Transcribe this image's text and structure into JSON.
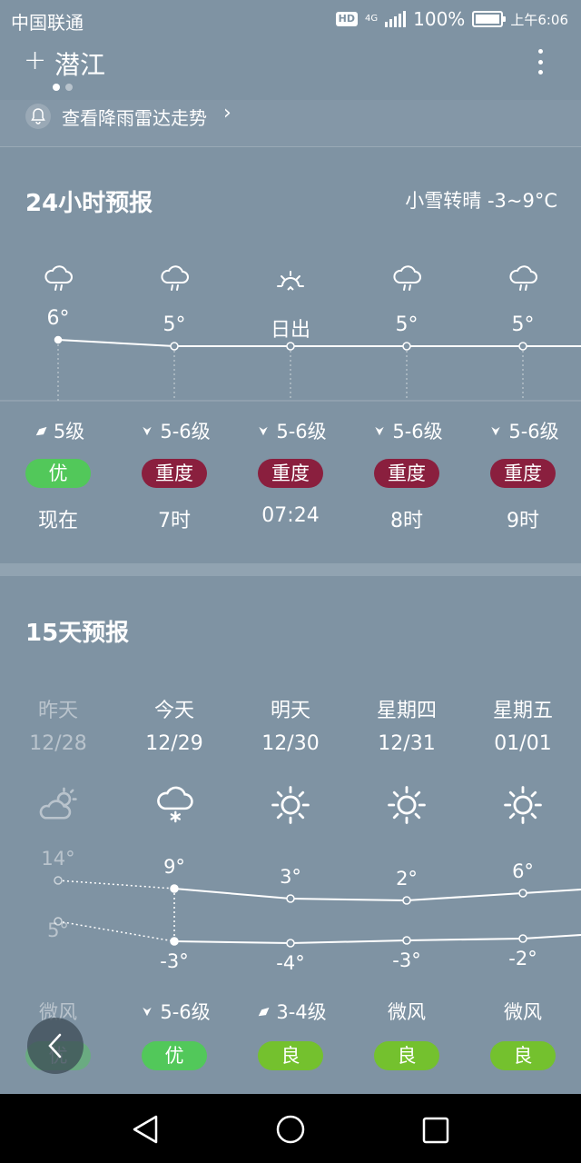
{
  "status": {
    "carrier": "中国联通",
    "hd": "HD",
    "net": "4G",
    "battery": "100%",
    "time": "上午6:06"
  },
  "header": {
    "city": "潜江",
    "page_count": 2,
    "active_page": 0
  },
  "radar": {
    "label": "查看降雨雷达走势",
    "chevron": "›"
  },
  "forecast24": {
    "title": "24小时预报",
    "summary": "小雪转晴 -3~9°C",
    "items": [
      {
        "icon": "cloud-drizzle-icon",
        "temp": "6°",
        "wind_icon": "wind-direction-northeast-icon",
        "wind": "5级",
        "aqi": "优",
        "aqi_level": "good",
        "time": "现在"
      },
      {
        "icon": "cloud-drizzle-icon",
        "temp": "5°",
        "wind_icon": "wind-direction-south-icon",
        "wind": "5-6级",
        "aqi": "重度",
        "aqi_level": "heavy",
        "time": "7时"
      },
      {
        "icon": "sunrise-icon",
        "temp": "日出",
        "wind_icon": "wind-direction-south-icon",
        "wind": "5-6级",
        "aqi": "重度",
        "aqi_level": "heavy",
        "time": "07:24"
      },
      {
        "icon": "cloud-drizzle-icon",
        "temp": "5°",
        "wind_icon": "wind-direction-south-icon",
        "wind": "5-6级",
        "aqi": "重度",
        "aqi_level": "heavy",
        "time": "8时"
      },
      {
        "icon": "cloud-drizzle-icon",
        "temp": "5°",
        "wind_icon": "wind-direction-south-icon",
        "wind": "5-6级",
        "aqi": "重度",
        "aqi_level": "heavy",
        "time": "9时"
      }
    ]
  },
  "forecast15": {
    "title": "15天预报",
    "days": [
      {
        "day": "昨天",
        "date": "12/28",
        "icon": "partly-cloudy-icon",
        "high": "14°",
        "low": "5°",
        "wind_icon": "",
        "wind": "微风",
        "aqi": "优",
        "aqi_level": "good",
        "past": true
      },
      {
        "day": "今天",
        "date": "12/29",
        "icon": "snow-icon",
        "high": "9°",
        "low": "-3°",
        "wind_icon": "wind-direction-south-icon",
        "wind": "5-6级",
        "aqi": "优",
        "aqi_level": "good",
        "past": false
      },
      {
        "day": "明天",
        "date": "12/30",
        "icon": "sun-icon",
        "high": "3°",
        "low": "-4°",
        "wind_icon": "wind-direction-northeast-icon",
        "wind": "3-4级",
        "aqi": "良",
        "aqi_level": "ok",
        "past": false
      },
      {
        "day": "星期四",
        "date": "12/31",
        "icon": "sun-icon",
        "high": "2°",
        "low": "-3°",
        "wind_icon": "",
        "wind": "微风",
        "aqi": "良",
        "aqi_level": "ok",
        "past": false
      },
      {
        "day": "星期五",
        "date": "01/01",
        "icon": "sun-icon",
        "high": "6°",
        "low": "-2°",
        "wind_icon": "",
        "wind": "微风",
        "aqi": "良",
        "aqi_level": "ok",
        "past": false
      }
    ]
  },
  "colors": {
    "background": "#7f93a3",
    "aqi_good": "#52c85a",
    "aqi_ok": "#74c12e",
    "aqi_heavy": "#8a1f3e"
  }
}
